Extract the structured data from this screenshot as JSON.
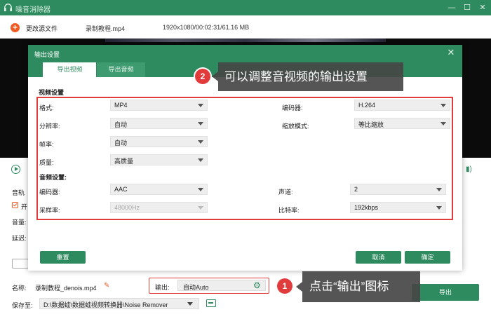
{
  "app": {
    "title": "噪音消除器",
    "window_controls": [
      "—",
      "☐",
      "✕"
    ]
  },
  "toolbar": {
    "change_source_label": "更改源文件",
    "file_name": "录制教程.mp4",
    "file_meta": "1920x1080/00:02:31/61.16 MB"
  },
  "left_panel": {
    "audio_track_label": "音轨",
    "enable_label": "开",
    "volume_label": "音量:",
    "delay_label": "延迟:"
  },
  "dialog": {
    "title": "输出设置",
    "tabs": [
      {
        "label": "导出视频",
        "active": true
      },
      {
        "label": "导出音频",
        "active": false
      }
    ],
    "video_section_label": "视频设置",
    "audio_section_label": "音频设置:",
    "video": {
      "format": {
        "label": "格式:",
        "value": "MP4"
      },
      "encoder": {
        "label": "编码器:",
        "value": "H.264"
      },
      "resolution": {
        "label": "分辨率:",
        "value": "自动"
      },
      "zoom_mode": {
        "label": "缩放模式:",
        "value": "等比缩放"
      },
      "frame_rate": {
        "label": "帧率:",
        "value": "自动"
      },
      "quality": {
        "label": "质量:",
        "value": "高质量"
      }
    },
    "audio": {
      "encoder": {
        "label": "编码器:",
        "value": "AAC"
      },
      "channel": {
        "label": "声道:",
        "value": "2"
      },
      "sample_rate": {
        "label": "采样率:",
        "value": "48000Hz",
        "disabled": true
      },
      "bitrate": {
        "label": "比特率:",
        "value": "192kbps"
      }
    },
    "reset_button": "重置",
    "cancel_button": "取消",
    "confirm_button": "确定"
  },
  "bottom": {
    "name_label": "名称:",
    "name_value": "录制教程_denois.mp4",
    "output_label": "输出:",
    "output_value": "自动Auto",
    "save_label": "保存至:",
    "save_path": "D:\\数据蛙\\数据蛙视频转换器\\Noise Remover",
    "export_button": "导出"
  },
  "annotations": {
    "callout1_text": "点击“输出”图标",
    "callout2_text": "可以调整音视频的输出设置",
    "badge1": "1",
    "badge2": "2"
  },
  "colors": {
    "accent_green": "#2e8b5f",
    "highlight_red": "#e23b3b",
    "orange": "#f05a22"
  }
}
